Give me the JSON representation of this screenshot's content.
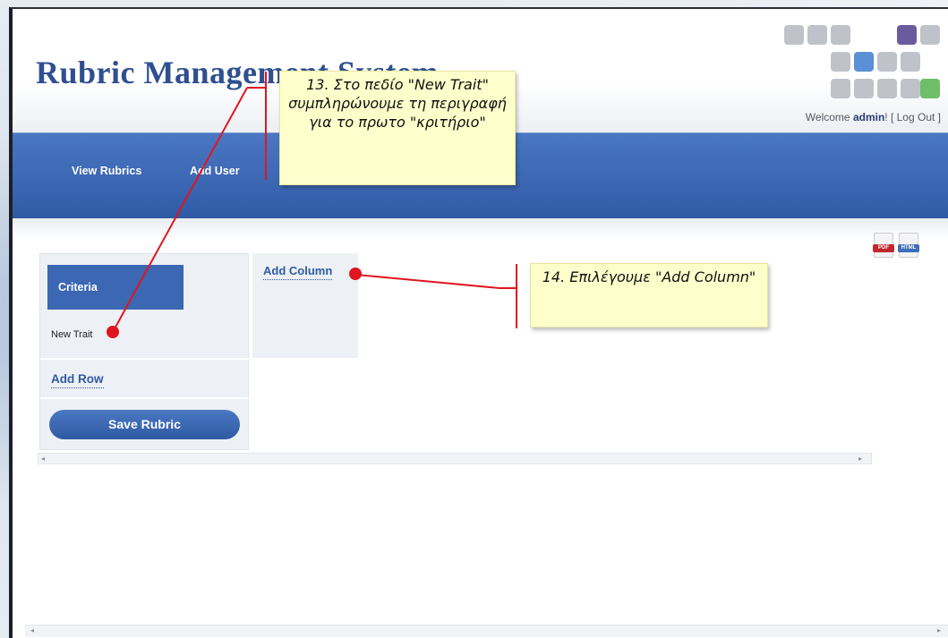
{
  "header": {
    "site_title": "Rubric Management System",
    "welcome_prefix": "Welcome ",
    "username": "admin",
    "welcome_suffix": "! [ ",
    "logout_label": "Log Out",
    "welcome_close": " ]"
  },
  "nav": {
    "items": [
      {
        "label": "View Rubrics"
      },
      {
        "label": "Add User"
      }
    ]
  },
  "export": {
    "pdf_label": "PDF",
    "html_label": "HTML"
  },
  "rubric": {
    "criteria_header": "Criteria",
    "trait_value": "New Trait",
    "add_row_label": "Add Row",
    "add_column_label": "Add Column",
    "save_label": "Save Rubric"
  },
  "annotations": {
    "step13": "13. Στο πεδίο \"New Trait\" συμπληρώνουμε τη περιγραφή για το πρωτο \"κριτήριο\"",
    "step14": "14. Επιλέγουμε \"Add Column\""
  },
  "colors": {
    "accent_blue": "#3c67b3",
    "marker_red": "#e0161f",
    "callout_yellow": "#ffffcc"
  }
}
